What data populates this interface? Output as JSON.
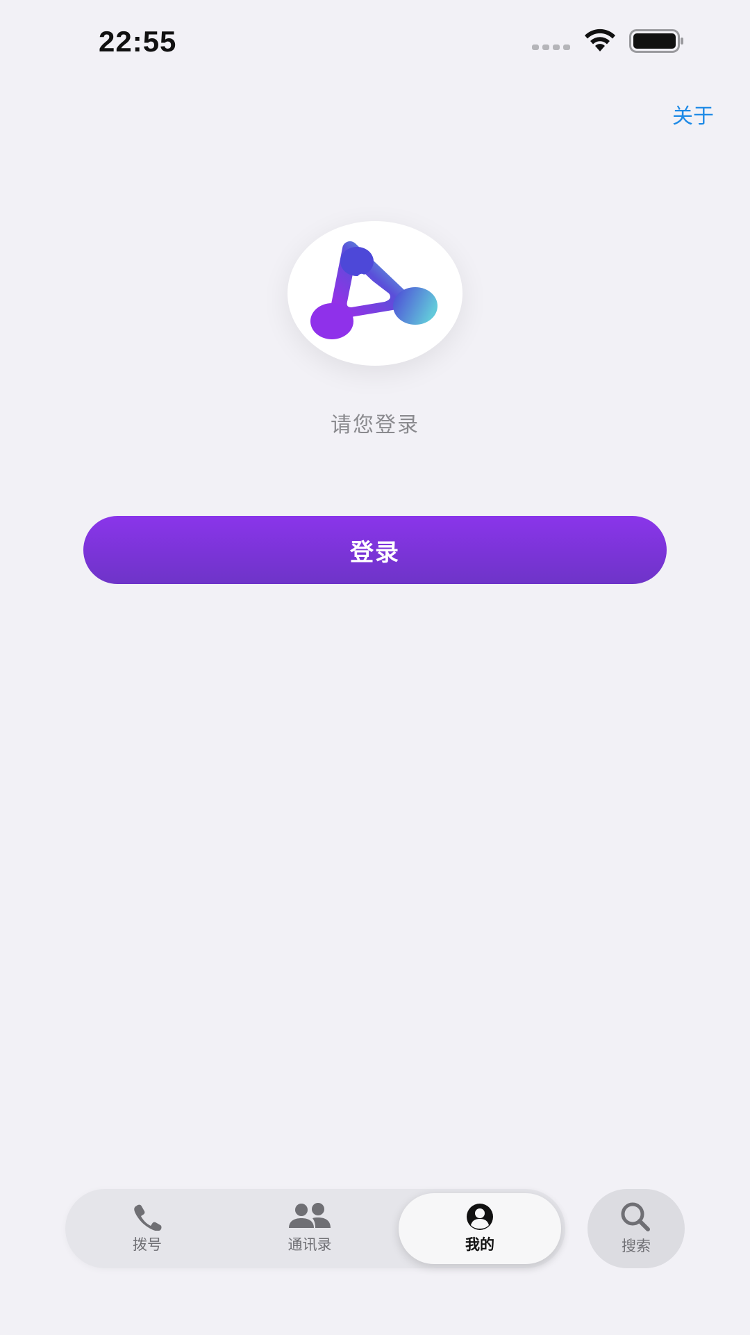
{
  "status_bar": {
    "time": "22:55",
    "icons": [
      "signal-dots-icon",
      "wifi-icon",
      "battery-icon"
    ]
  },
  "header": {
    "about_label": "关于"
  },
  "main": {
    "logo_icon": "app-logo-icon",
    "prompt": "请您登录",
    "login_label": "登录"
  },
  "tab_bar": {
    "tabs": [
      {
        "label": "拨号",
        "icon": "phone-icon"
      },
      {
        "label": "通讯录",
        "icon": "contacts-icon"
      },
      {
        "label": "我的",
        "icon": "person-circle-icon",
        "active": true
      }
    ],
    "search_label": "搜索",
    "search_icon": "search-icon"
  },
  "colors": {
    "accent": "#8a35ea",
    "link": "#1e8ae6",
    "background": "#f2f1f6"
  }
}
